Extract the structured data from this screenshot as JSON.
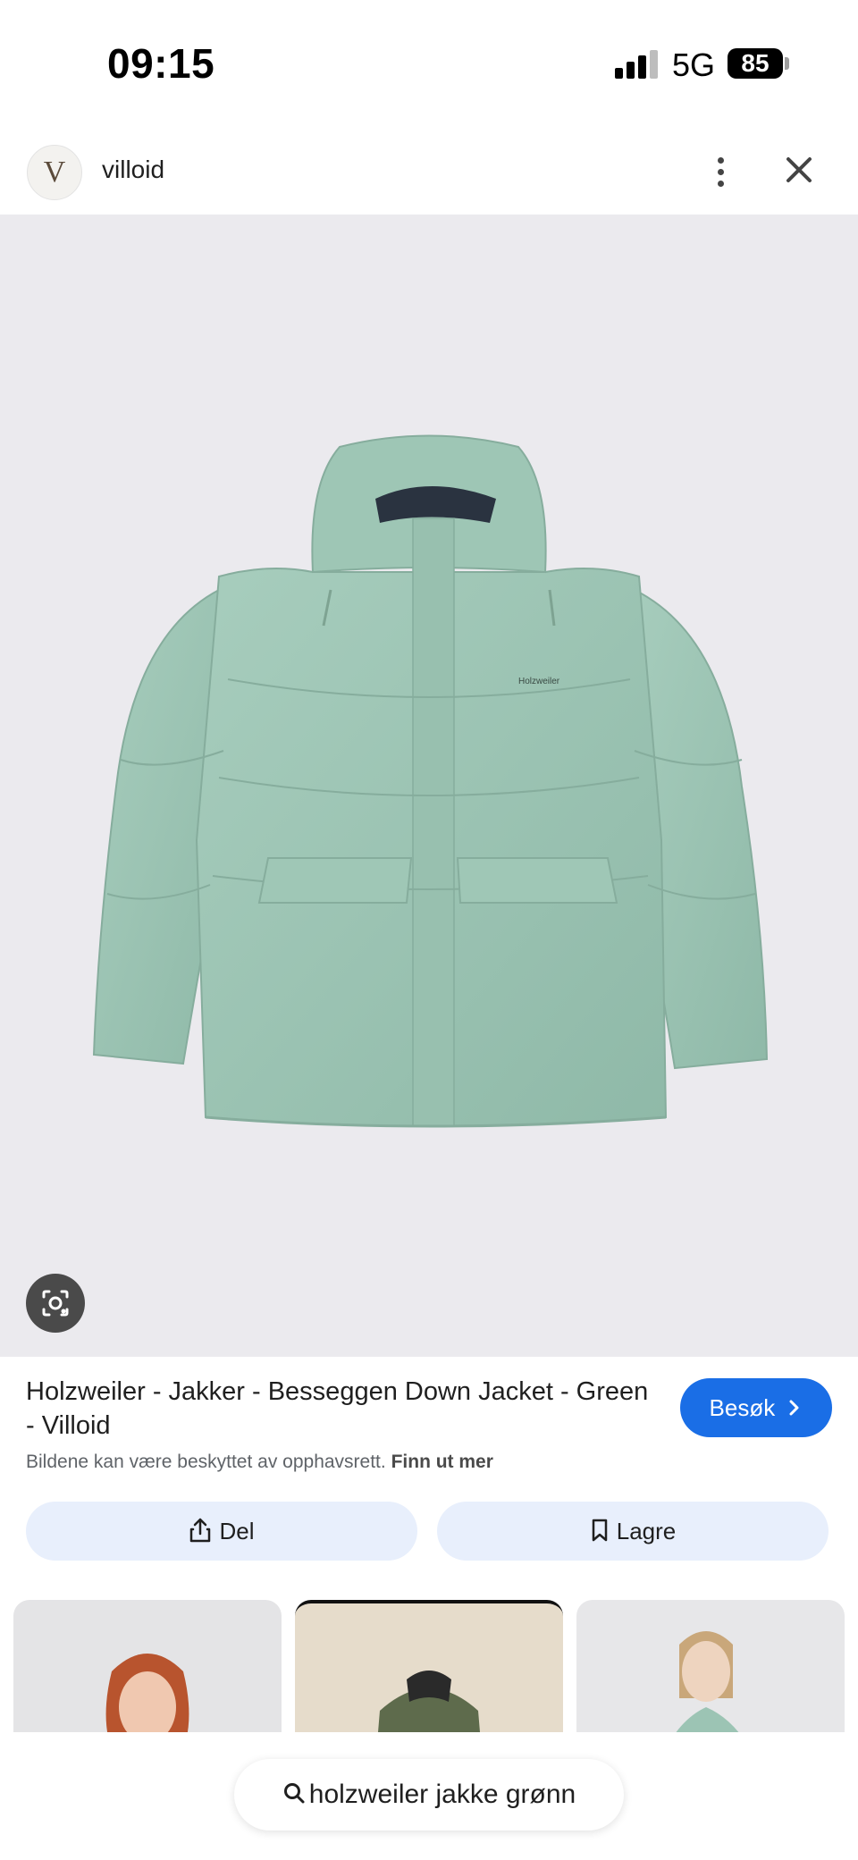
{
  "status_bar": {
    "time": "09:15",
    "network": "5G",
    "battery": "85"
  },
  "source": {
    "avatar_letter": "V",
    "name": "villoid"
  },
  "product": {
    "title": "Holzweiler - Jakker - Besseggen Down Jacket - Green - Villoid",
    "visit_label": "Besøk",
    "copyright_text": "Bildene kan være beskyttet av opphavsrett.",
    "copyright_link": "Finn ut mer",
    "jacket_brand_mark": "Holzweiler"
  },
  "actions": {
    "share_label": "Del",
    "save_label": "Lagre"
  },
  "search": {
    "query": "holzweiler jakke grønn"
  },
  "colors": {
    "accent": "#1a6ee6",
    "jacket": "#9cc4b4",
    "background": "#ebeaee",
    "action_bg": "#e8effc"
  },
  "icons": [
    "cellular-signal-icon",
    "battery-icon",
    "more-vert-icon",
    "close-icon",
    "google-lens-icon",
    "chevron-right-icon",
    "share-icon",
    "bookmark-icon",
    "search-icon"
  ]
}
